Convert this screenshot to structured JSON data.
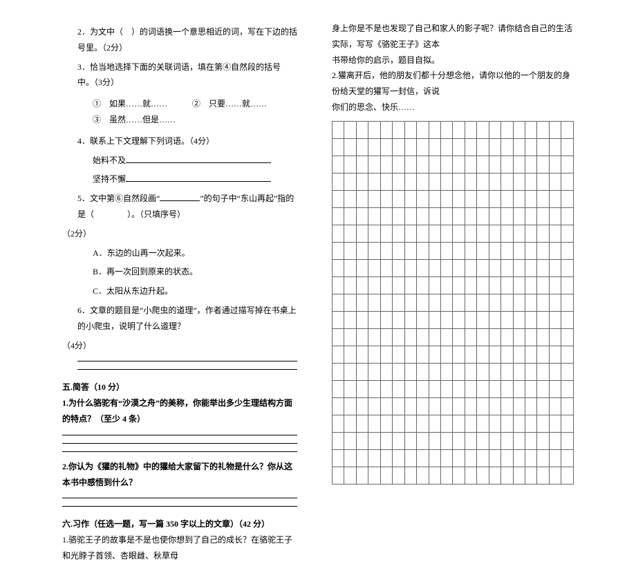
{
  "left": {
    "q2": "2．为文中（　）的词语换一个意思相近的词，写在下边的括号里。（2分）",
    "q3": "3．恰当地选择下面的关联词语，填在第④自然段的括号中。（3分）",
    "q3opts": "①　如果……就……　　　②　只要……就……　　　③　虽然……但是……",
    "q4": "4．联系上下文理解下列词语。（4分）",
    "q4a": "始料不及",
    "q4b": "坚持不懈",
    "q5a": "5．文中第⑥自然段画“",
    "q5b": "”的句子中“东山再起”指的是（　　　　）。（只填序号）",
    "q5tail": "（2分）",
    "q5A": "A．东边的山再一次起来。",
    "q5B": "B．再一次回到原来的状态。",
    "q5C": "C．太阳从东边升起。",
    "q6a": "6．文章的题目是“小爬虫的道理”，作者通过描写掉在书桌上的小爬虫，说明了什么道理？",
    "q6tail": "（4分）",
    "sec5": "五.简答（10 分）",
    "sa1": "1.为什么骆驼有“沙漠之舟”的美称，你能举出多少生理结构方面的特点？（至少 4 条）",
    "sa2": "2.你认为《獾的礼物》中的獾给大家留下的礼物是什么？你从这本书中感悟到什么？",
    "sec6": "六.习作（任选一题，写一篇 350 字以上的文章）（42 分）",
    "w1": "1.骆驼王子的故事是不是也使你想到了自己的成长？在骆驼王子和光脖子首领、杏眼雌、秋草母"
  },
  "right": {
    "r1": "身上你是不是也发现了自己和家人的影子呢？请你结合自己的生活实际，写写《骆驼王子》这本",
    "r2": "书带给你的启示，题目自拟。",
    "r3": "2.獾离开后，他的朋友们都十分想念他，请你以他的一个朋友的身份给天堂的獾写一封信，诉说",
    "r4": "你们的思念、快乐……"
  }
}
